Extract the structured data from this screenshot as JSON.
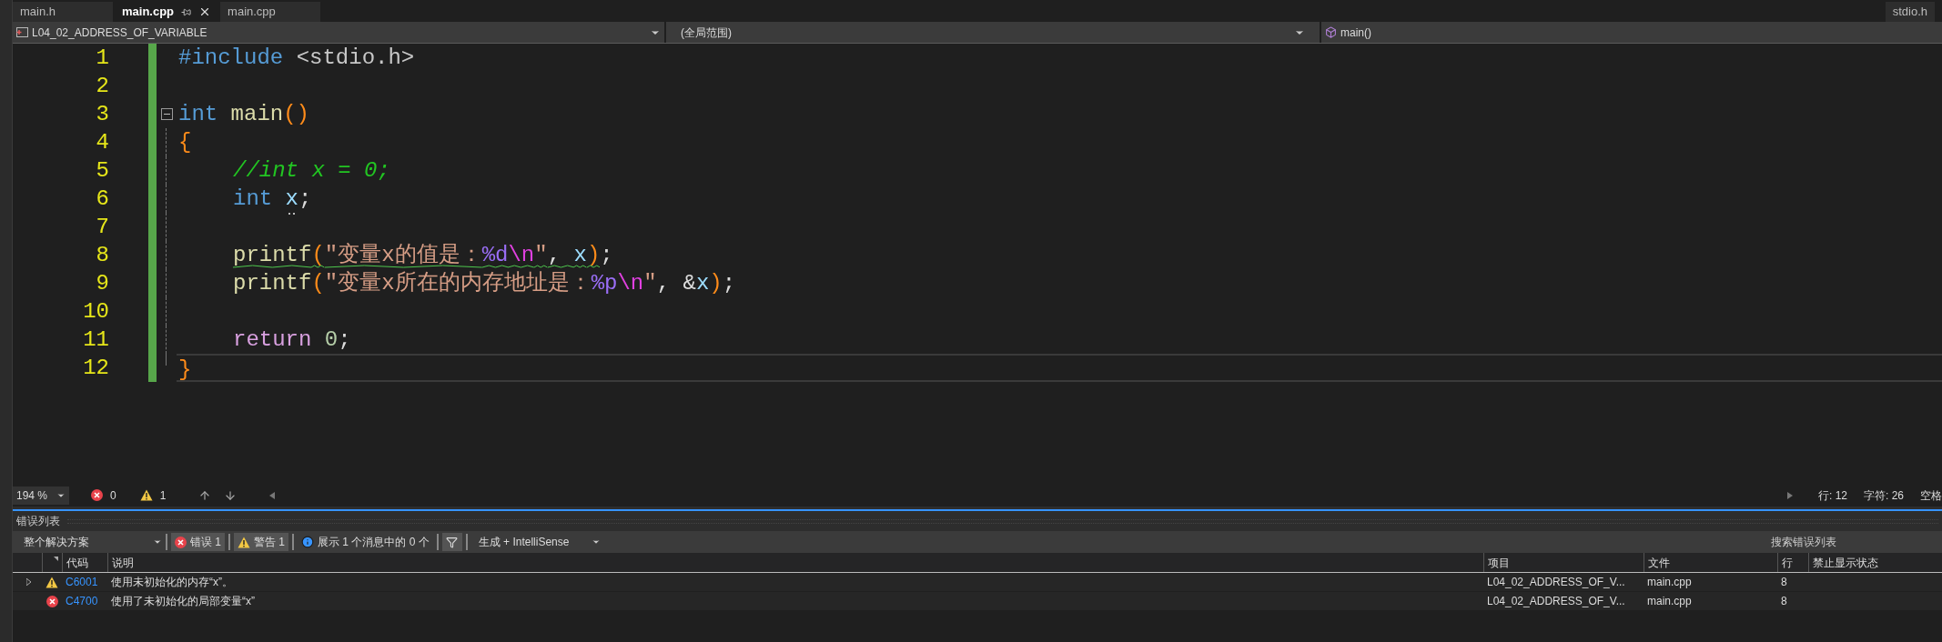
{
  "tabs": [
    {
      "label": "main.h",
      "selected": false
    },
    {
      "label": "main.cpp",
      "selected": true
    },
    {
      "label": "main.cpp",
      "selected": false
    }
  ],
  "right_tabs": [
    {
      "label": "stdio.h",
      "selected": false
    }
  ],
  "navigation": {
    "project": "L04_02_ADDRESS_OF_VARIABLE",
    "scope": "(全局范围)",
    "member": "main()"
  },
  "editor": {
    "lines": [
      {
        "number": "1",
        "changed": true,
        "current": false,
        "indented": false,
        "tokens": [
          {
            "kind": "preproc",
            "text": "#include "
          },
          {
            "kind": "header",
            "text": "<stdio.h>"
          }
        ]
      },
      {
        "number": "2",
        "changed": true,
        "current": false
      },
      {
        "number": "3",
        "changed": true,
        "current": false,
        "indented": false,
        "expanded": true,
        "tokens": [
          {
            "kind": "keyword",
            "text": "int "
          },
          {
            "kind": "function",
            "text": "main"
          },
          {
            "kind": "paren",
            "text": "()"
          }
        ]
      },
      {
        "number": "4",
        "changed": true,
        "current": false,
        "indented": false,
        "tokens": [
          {
            "kind": "paren",
            "text": "{"
          }
        ]
      },
      {
        "number": "5",
        "changed": true,
        "current": false,
        "indented": true,
        "tokens": [
          {
            "kind": "comment",
            "text": "//int x = 0;"
          }
        ]
      },
      {
        "number": "6",
        "changed": true,
        "current": false,
        "indented": true,
        "tokens": [
          {
            "kind": "keyword",
            "text": "int "
          },
          {
            "kind": "variable",
            "text": "x",
            "hint": true
          },
          {
            "kind": "plain",
            "text": ";"
          }
        ]
      },
      {
        "number": "7",
        "changed": true,
        "current": false
      },
      {
        "number": "8",
        "changed": true,
        "current": false,
        "indented": true,
        "tokens": [
          {
            "kind": "function",
            "text": "printf",
            "squiggle": true
          },
          {
            "kind": "paren",
            "text": "(",
            "squiggle": true
          },
          {
            "kind": "string",
            "text": "\"变量x的值是：",
            "squiggle": true
          },
          {
            "kind": "format",
            "text": "%d",
            "squiggle": true
          },
          {
            "kind": "escape",
            "text": "\\n",
            "squiggle": true
          },
          {
            "kind": "string",
            "text": "\"",
            "squiggle": true
          },
          {
            "kind": "plain",
            "text": ", ",
            "squiggle": true
          },
          {
            "kind": "variable",
            "text": "x",
            "squiggle": true
          },
          {
            "kind": "paren",
            "text": ")",
            "squiggle": true
          },
          {
            "kind": "plain",
            "text": ";",
            "squiggle": false
          }
        ]
      },
      {
        "number": "9",
        "changed": true,
        "current": false,
        "indented": true,
        "tokens": [
          {
            "kind": "function",
            "text": "printf"
          },
          {
            "kind": "paren",
            "text": "("
          },
          {
            "kind": "string",
            "text": "\"变量x所在的内存地址是："
          },
          {
            "kind": "format",
            "text": "%p"
          },
          {
            "kind": "escape",
            "text": "\\n"
          },
          {
            "kind": "string",
            "text": "\""
          },
          {
            "kind": "plain",
            "text": ", &"
          },
          {
            "kind": "variable",
            "text": "x"
          },
          {
            "kind": "paren",
            "text": ")"
          },
          {
            "kind": "plain",
            "text": ";"
          }
        ]
      },
      {
        "number": "10",
        "changed": true,
        "current": false
      },
      {
        "number": "11",
        "changed": true,
        "current": false,
        "indented": true,
        "tokens": [
          {
            "kind": "control",
            "text": "return "
          },
          {
            "kind": "number",
            "text": "0"
          },
          {
            "kind": "plain",
            "text": ";"
          }
        ]
      },
      {
        "number": "12",
        "changed": true,
        "current": true,
        "indented": false,
        "tokens": [
          {
            "kind": "paren",
            "text": "}"
          }
        ]
      }
    ]
  },
  "status": {
    "zoom": "194 %",
    "errors": "0",
    "warnings": "1",
    "line": "行: 12",
    "column": "字符: 26",
    "more": "空格"
  },
  "error_list": {
    "title": "错误列表",
    "scope": "整个解决方案",
    "filters": [
      {
        "kind": "error",
        "label": "错误 1",
        "selected": true
      },
      {
        "kind": "warning",
        "label": "警告 1",
        "selected": true
      },
      {
        "kind": "info",
        "label": "展示 1 个消息中的 0 个",
        "selected": false
      }
    ],
    "source": "生成 + IntelliSense",
    "search": {
      "placeholder": "搜索错误列表"
    },
    "columns": [
      "代码",
      "说明",
      "项目",
      "文件",
      "行",
      "禁止显示状态"
    ],
    "rows": [
      {
        "kind": "warning",
        "code": "C6001",
        "description": "使用未初始化的内存“x”。",
        "project": "L04_02_ADDRESS_OF_V...",
        "file": "main.cpp",
        "line": "8"
      },
      {
        "kind": "error",
        "code": "C4700",
        "description": "使用了未初始化的局部变量“x”",
        "project": "L04_02_ADDRESS_OF_V...",
        "file": "main.cpp",
        "line": "8"
      }
    ]
  }
}
